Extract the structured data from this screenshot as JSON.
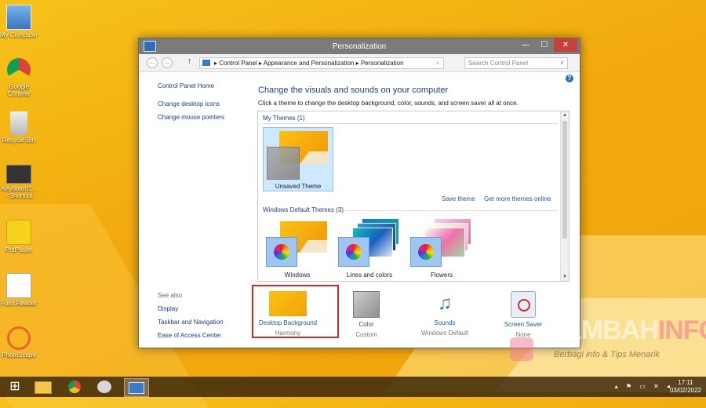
{
  "desktop_icons": [
    {
      "label": "My Computer"
    },
    {
      "label": "Google Chrome"
    },
    {
      "label": "Recycle Bin"
    },
    {
      "label": "KeyboardT... - Shortcut"
    },
    {
      "label": "PotPlayer"
    },
    {
      "label": "Foxit Reader"
    },
    {
      "label": "PhotoScape"
    }
  ],
  "window": {
    "title": "Personalization",
    "controls": {
      "minimize": "—",
      "maximize": "☐",
      "close": "✕"
    },
    "nav": {
      "back": "←",
      "forward": "→",
      "up": "↑"
    },
    "breadcrumb": "▸  Control Panel  ▸  Appearance and Personalization  ▸  Personalization",
    "search_placeholder": "Search Control Panel",
    "search_icon": "⌕",
    "dropdown": "⌄",
    "help": "?"
  },
  "left_pane": {
    "home": "Control Panel Home",
    "links": [
      "Change desktop icons",
      "Change mouse pointers"
    ]
  },
  "see_also": {
    "label": "See also",
    "links": [
      "Display",
      "Taskbar and Navigation",
      "Ease of Access Center"
    ]
  },
  "main": {
    "heading": "Change the visuals and sounds on your computer",
    "subtext": "Click a theme to change the desktop background, color, sounds, and screen saver all at once.",
    "my_themes_label": "My Themes (1)",
    "my_themes": [
      {
        "name": "Unsaved Theme"
      }
    ],
    "save_theme": "Save theme",
    "get_more": "Get more themes online",
    "default_themes_label": "Windows Default Themes (3)",
    "default_themes": [
      {
        "name": "Windows"
      },
      {
        "name": "Lines and colors"
      },
      {
        "name": "Flowers"
      }
    ]
  },
  "bottom": [
    {
      "label": "Desktop Background",
      "sub": "Harmony"
    },
    {
      "label": "Color",
      "sub": "Custom"
    },
    {
      "label": "Sounds",
      "sub": "Windows Default"
    },
    {
      "label": "Screen Saver",
      "sub": "None"
    }
  ],
  "watermark": {
    "brand_a": "TAMBAH",
    "brand_b": "INFO",
    "tagline": "Berbagi info & Tips Menarik"
  },
  "taskbar": {
    "start_icon": "⊞",
    "tray_icons": "▴ ⚑ ▭ ✕ ◂",
    "time": "17:11",
    "date": "03/02/2022"
  }
}
